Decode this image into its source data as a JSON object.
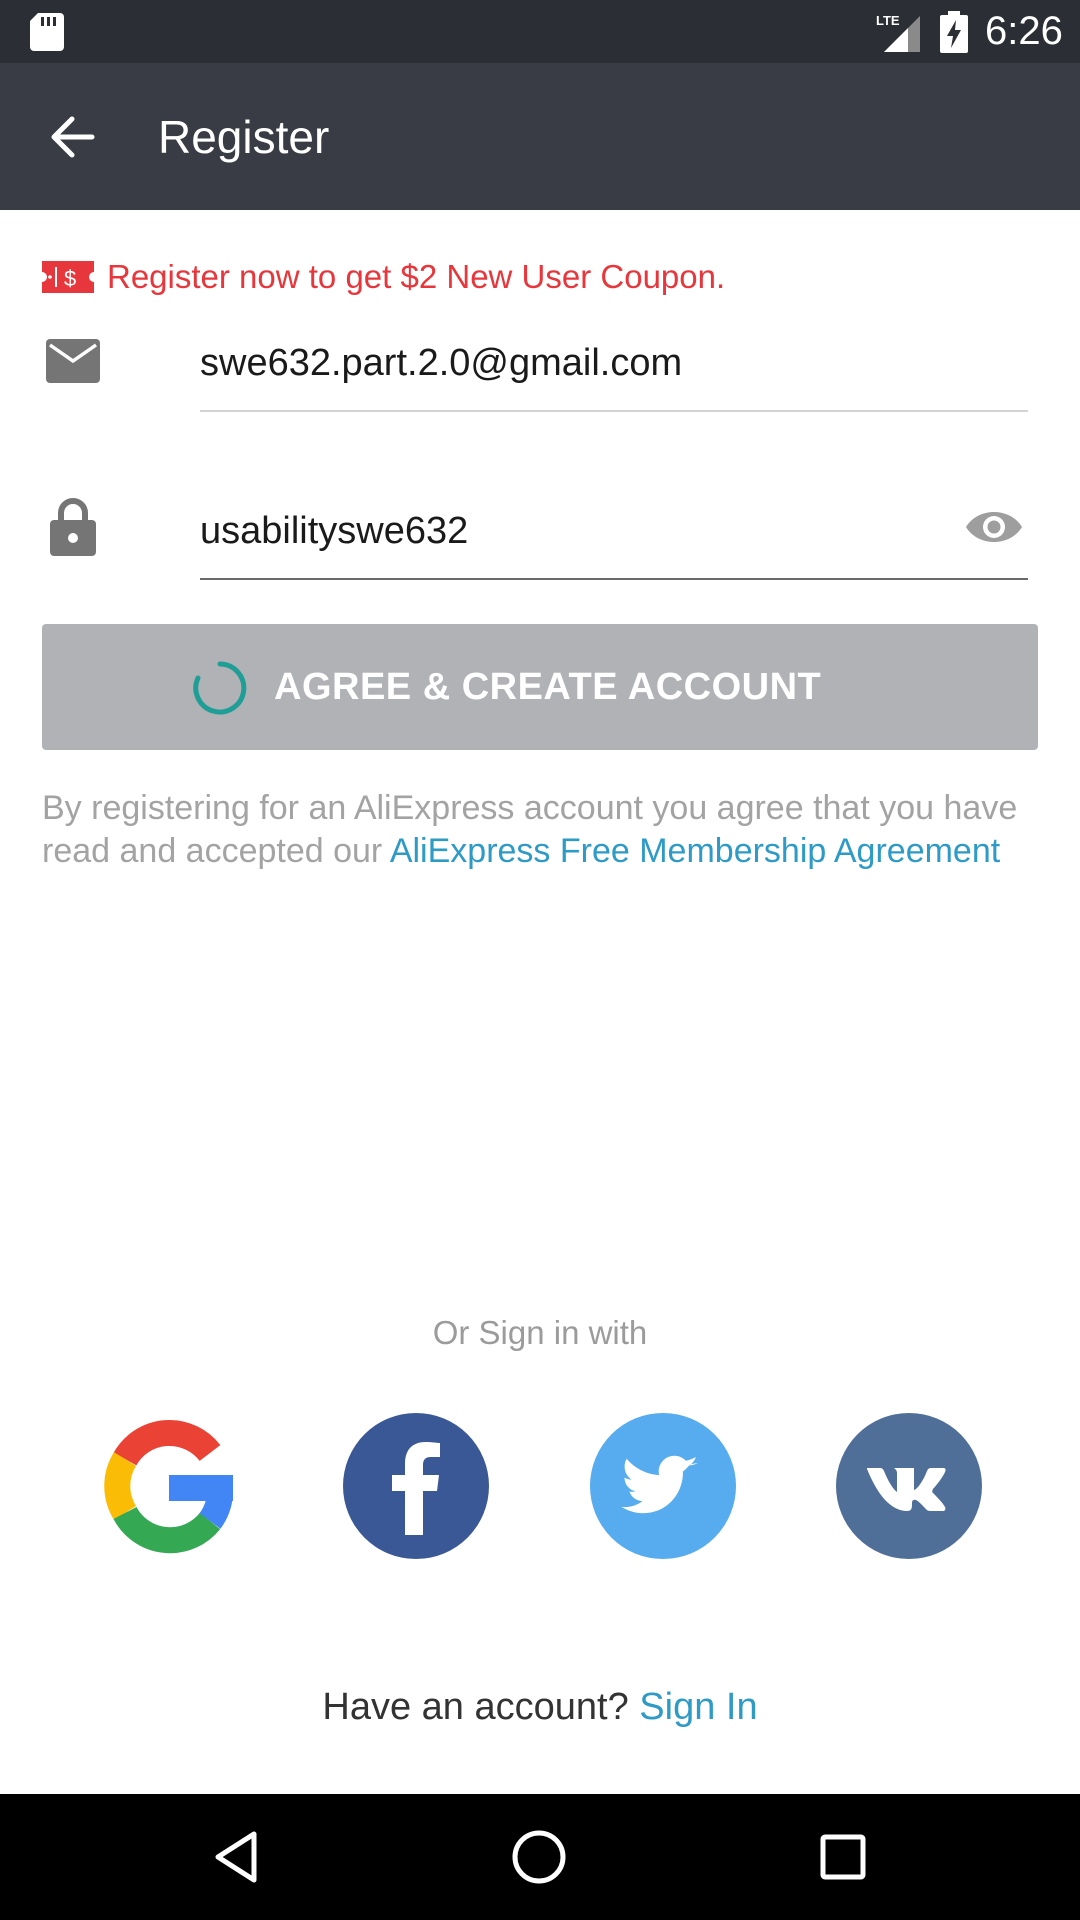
{
  "status_bar": {
    "time": "6:26",
    "network": "LTE",
    "icons": [
      "sd-card-icon",
      "signal-icon",
      "battery-charging-icon"
    ]
  },
  "app_bar": {
    "title": "Register",
    "back_icon": "arrow-back-icon"
  },
  "coupon": {
    "text": "Register now to get $2 New User Coupon.",
    "icon": "coupon-icon",
    "color": "#e8373c"
  },
  "email": {
    "value": "swe632.part.2.0@gmail.com",
    "icon": "mail-icon"
  },
  "password": {
    "value": "usabilityswe632",
    "icon": "lock-icon",
    "toggle_icon": "eye-icon"
  },
  "create_button": {
    "label": "AGREE & CREATE ACCOUNT",
    "loading": true
  },
  "terms": {
    "text": "By registering for an AliExpress account you agree that you have read and accepted our ",
    "link": "AliExpress Free Membership Agreement"
  },
  "social": {
    "heading": "Or Sign in with",
    "providers": [
      "google-icon",
      "facebook-icon",
      "twitter-icon",
      "vk-icon"
    ]
  },
  "footer": {
    "prompt": "Have an account?",
    "link": "Sign In"
  },
  "colors": {
    "status_bar": "#2b2e34",
    "app_bar": "#393c44",
    "link": "#2e9ac6",
    "button_disabled": "#b1b2b6",
    "spinner": "#1e9e96"
  }
}
